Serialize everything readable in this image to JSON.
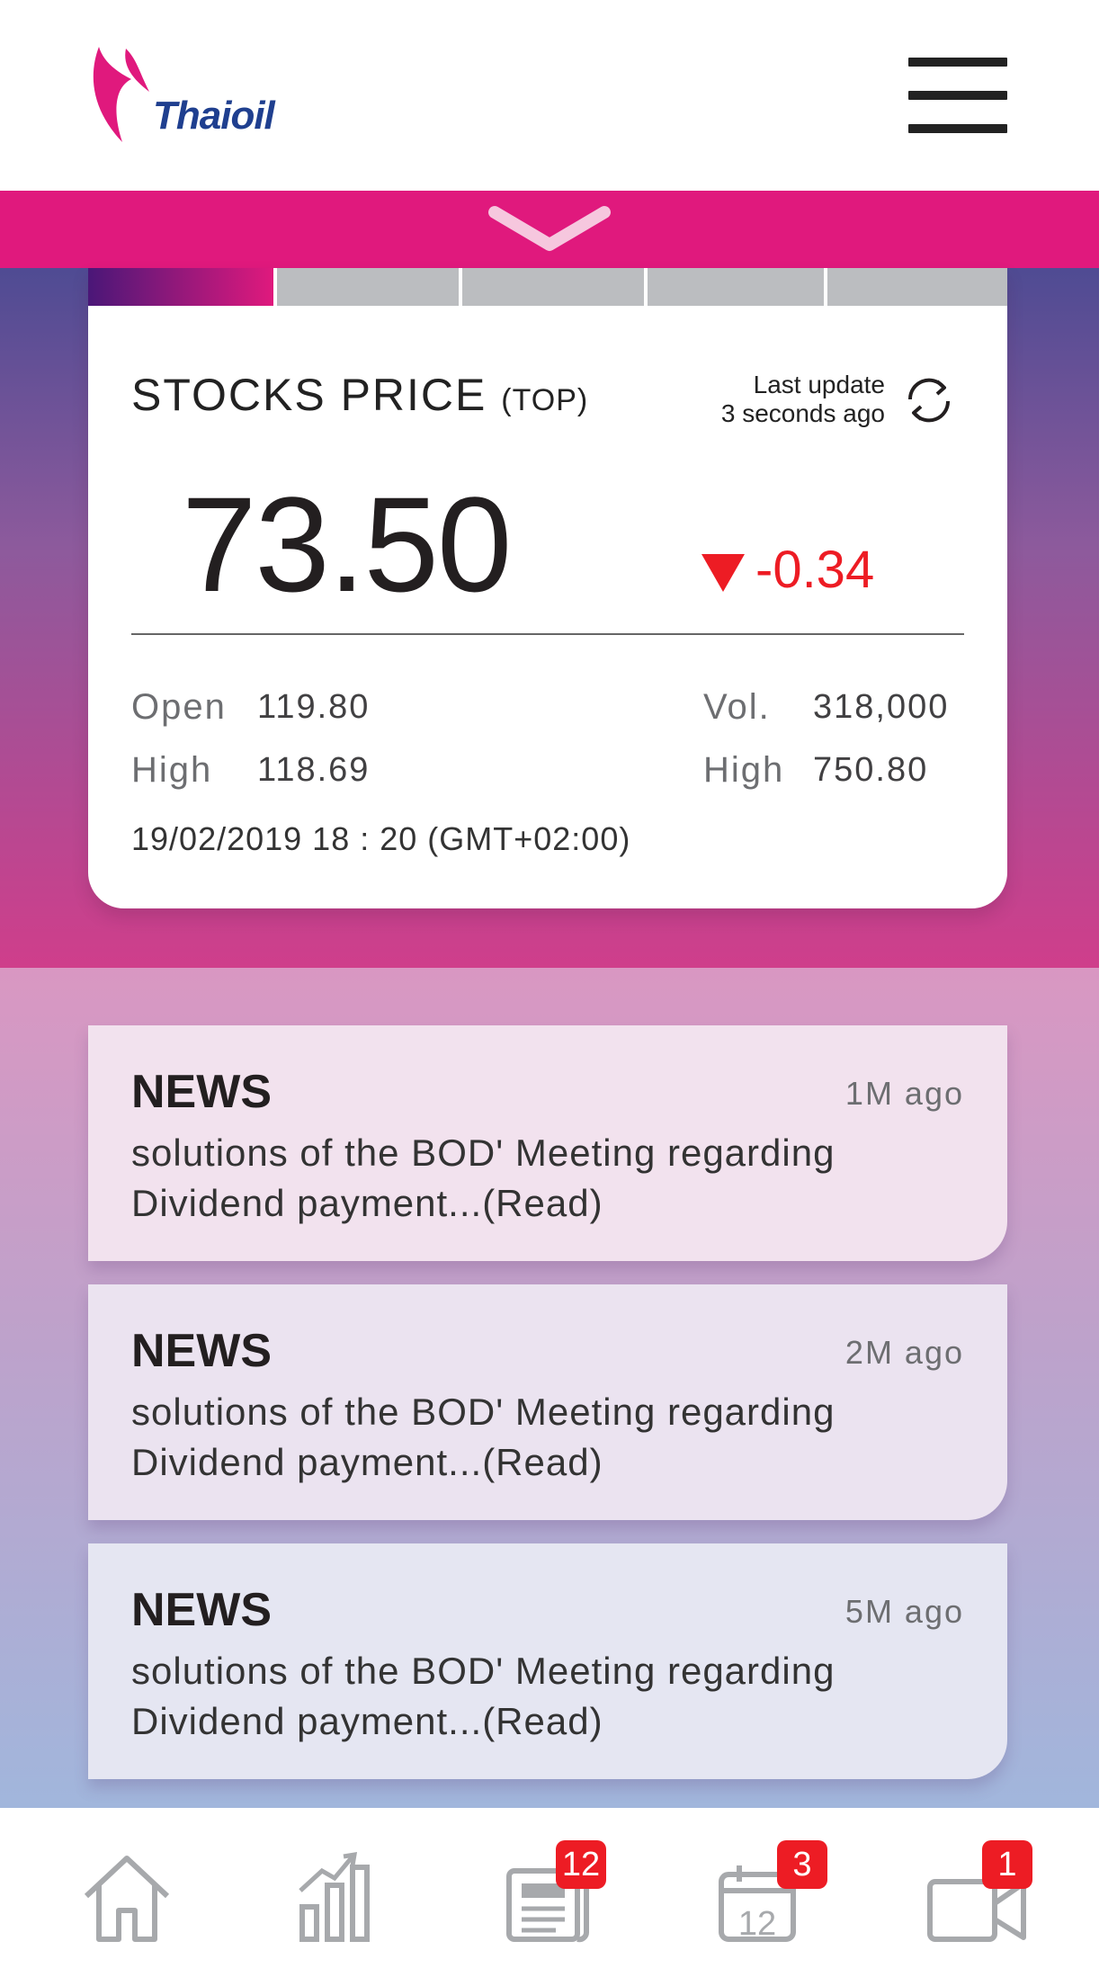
{
  "header": {
    "logo_text": "Thaioil",
    "menu_icon": "hamburger-menu-icon",
    "brand_color": "#e0197d"
  },
  "stock": {
    "tabs_active_index": 0,
    "tab_count": 5,
    "title": "STOCKS PRICE",
    "symbol": "(TOP)",
    "last_update_line1": "Last update",
    "last_update_line2": "3 seconds ago",
    "price": "73.50",
    "change": "-0.34",
    "change_direction": "down",
    "change_color": "#ed1c24",
    "open_label": "Open",
    "open_value": "119.80",
    "high_label": "High",
    "high_value": "118.69",
    "vol_label": "Vol.",
    "vol_value": "318,000",
    "high2_label": "High",
    "high2_value": "750.80",
    "timestamp": "19/02/2019  18 : 20 (GMT+02:00)"
  },
  "news": [
    {
      "title": "NEWS",
      "time": "1M ago",
      "body": "solutions of the BOD' Meeting regarding Dividend payment...(Read)",
      "bg": "#f2e2ee"
    },
    {
      "title": "NEWS",
      "time": "2M ago",
      "body": "solutions of the BOD' Meeting regarding Dividend payment...(Read)",
      "bg": "#ebe3f0"
    },
    {
      "title": "NEWS",
      "time": "5M ago",
      "body": "solutions of the BOD' Meeting regarding Dividend payment...(Read)",
      "bg": "#e5e6f2"
    }
  ],
  "nav": {
    "items": [
      {
        "icon": "home-icon"
      },
      {
        "icon": "stock-chart-icon"
      },
      {
        "icon": "newspaper-icon",
        "badge": "12"
      },
      {
        "icon": "calendar-icon",
        "calendar_day": "12",
        "badge": "3"
      },
      {
        "icon": "video-icon",
        "badge": "1"
      }
    ]
  }
}
